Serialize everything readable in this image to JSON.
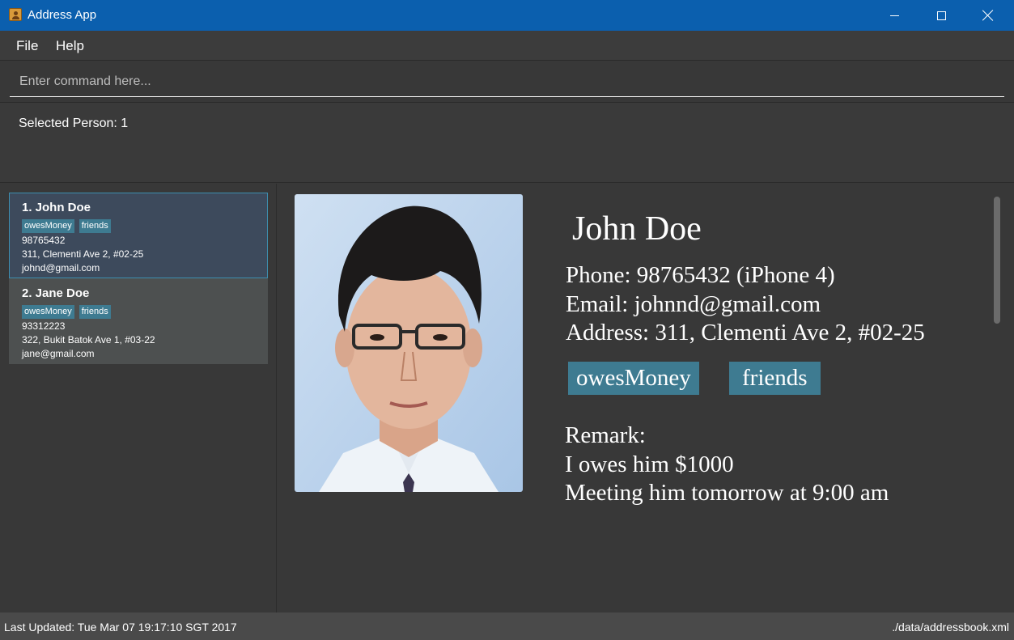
{
  "window": {
    "title": "Address App"
  },
  "menu": {
    "file": "File",
    "help": "Help"
  },
  "command": {
    "placeholder": "Enter command here..."
  },
  "result": {
    "text": "Selected Person: 1"
  },
  "persons": [
    {
      "name": "1. John Doe",
      "tags": [
        "owesMoney",
        "friends"
      ],
      "phone": "98765432",
      "address": "311, Clementi Ave 2, #02-25",
      "email": "johnd@gmail.com"
    },
    {
      "name": "2. Jane Doe",
      "tags": [
        "owesMoney",
        "friends"
      ],
      "phone": "93312223",
      "address": "322, Bukit Batok Ave 1, #03-22",
      "email": "jane@gmail.com"
    }
  ],
  "detail": {
    "name": "John Doe",
    "phone": "Phone: 98765432 (iPhone 4)",
    "email": "Email: johnnd@gmail.com",
    "address": "Address: 311, Clementi Ave 2, #02-25",
    "tags": [
      "owesMoney",
      "friends"
    ],
    "remark_label": "Remark:",
    "remark_lines": [
      "I owes him $1000",
      "Meeting him tomorrow at 9:00 am"
    ]
  },
  "status": {
    "last_updated": "Last Updated: Tue Mar 07 19:17:10 SGT 2017",
    "file_path": "./data/addressbook.xml"
  },
  "colors": {
    "titlebar": "#0b5fae",
    "background": "#383838",
    "tag": "#3e7b91",
    "selected_card": "#3d4a5c",
    "selected_border": "#3d8fb0"
  }
}
